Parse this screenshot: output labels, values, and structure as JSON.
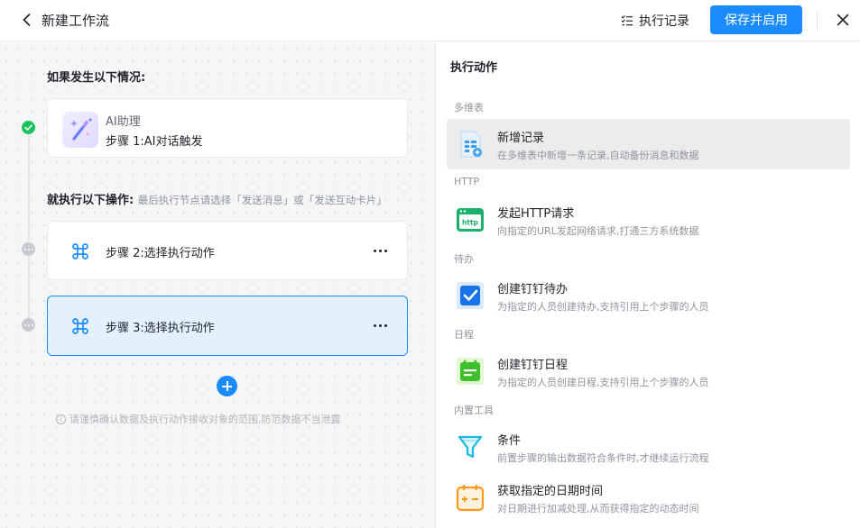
{
  "header": {
    "title": "新建工作流",
    "history_label": "执行记录",
    "save_label": "保存并启用"
  },
  "canvas": {
    "trigger_title": "如果发生以下情况:",
    "trigger_card": {
      "sub": "AI助理",
      "main": "步骤 1:AI对话触发"
    },
    "action_title": "就执行以下操作:",
    "action_hint": "最后执行节点请选择「发送消息」或「发送互动卡片」",
    "steps": [
      {
        "label": "步骤 2:选择执行动作"
      },
      {
        "label": "步骤 3:选择执行动作"
      }
    ],
    "notice": "请谨慎确认数据及执行动作接收对象的范围,防范数据不当泄露"
  },
  "panel": {
    "title": "执行动作",
    "categories": [
      "多维表",
      "HTTP",
      "待办",
      "日程",
      "内置工具"
    ],
    "items": [
      {
        "name": "新增记录",
        "desc": "在多维表中新增一条记录,自动备份消息和数据",
        "icon": "table-add-icon"
      },
      {
        "name": "发起HTTP请求",
        "desc": "向指定的URL发起网络请求,打通三方系统数据",
        "icon": "http-icon"
      },
      {
        "name": "创建钉钉待办",
        "desc": "为指定的人员创建待办,支持引用上个步骤的人员",
        "icon": "todo-check-icon"
      },
      {
        "name": "创建钉钉日程",
        "desc": "为指定的人员创建日程,支持引用上个步骤的人员",
        "icon": "calendar-icon"
      },
      {
        "name": "条件",
        "desc": "前置步骤的输出数据符合条件时,才继续运行流程",
        "icon": "filter-icon"
      },
      {
        "name": "获取指定的日期时间",
        "desc": "对日期进行加减处理,从而获得指定的动态时间",
        "icon": "date-calc-icon"
      }
    ]
  },
  "colors": {
    "primary": "#1a8cff",
    "success": "#19c35c",
    "selected_bg": "#e3f1fd"
  }
}
